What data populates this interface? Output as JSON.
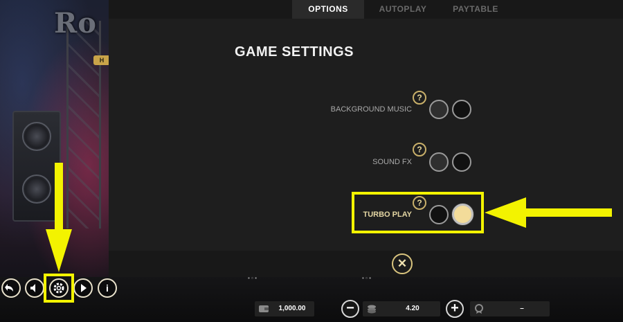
{
  "game": {
    "logo_text": "Ro",
    "badge_text": "H"
  },
  "settings_panel": {
    "tabs": [
      {
        "label": "OPTIONS",
        "active": true
      },
      {
        "label": "AUTOPLAY",
        "active": false
      },
      {
        "label": "PAYTABLE",
        "active": false
      }
    ],
    "title": "GAME SETTINGS",
    "settings": [
      {
        "label": "BACKGROUND MUSIC",
        "help": "?",
        "enabled": false
      },
      {
        "label": "SOUND FX",
        "help": "?",
        "enabled": false
      },
      {
        "label": "TURBO PLAY",
        "help": "?",
        "enabled": true
      }
    ],
    "close_symbol": "✕"
  },
  "controls": {
    "back_icon": "undo-arrow-icon",
    "sound_icon": "speaker-icon",
    "settings_icon": "gear-icon",
    "autoplay_icon": "play-icon",
    "info_label": "i"
  },
  "bottom_bar": {
    "balance": "1,000.00",
    "stake": "4.20",
    "win": "–",
    "minus_label": "−",
    "plus_label": "+"
  },
  "annotations": {
    "arrow_color": "#f3f300",
    "highlight_color": "#f3f300"
  },
  "colors": {
    "panel_bg": "#1e1e1e",
    "toggle_on": "#f3dc9a",
    "accent_gold": "#c9b06a"
  }
}
